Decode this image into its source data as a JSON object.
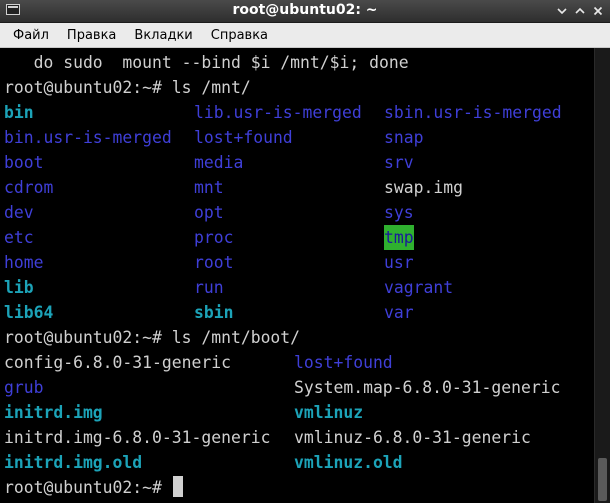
{
  "window": {
    "title": "root@ubuntu02: ~"
  },
  "menu": [
    "Файл",
    "Правка",
    "Вкладки",
    "Справка"
  ],
  "terminal": {
    "line0": "   do sudo  mount --bind $i /mnt/$i; done",
    "prompt1": "root@ubuntu02:~# ls /mnt/",
    "mnt_col1": [
      "bin",
      "bin.usr-is-merged",
      "boot",
      "cdrom",
      "dev",
      "etc",
      "home",
      "lib",
      "lib64"
    ],
    "mnt_col2": [
      "lib.usr-is-merged",
      "lost+found",
      "media",
      "mnt",
      "opt",
      "proc",
      "root",
      "run",
      "sbin"
    ],
    "mnt_col3": [
      "sbin.usr-is-merged",
      "snap",
      "srv",
      "swap.img",
      "sys",
      "tmp",
      "usr",
      "vagrant",
      "var"
    ],
    "prompt2": "root@ubuntu02:~# ls /mnt/boot/",
    "boot_col1": [
      "config-6.8.0-31-generic",
      "grub",
      "initrd.img",
      "initrd.img-6.8.0-31-generic",
      "initrd.img.old"
    ],
    "boot_col2": [
      "lost+found",
      "System.map-6.8.0-31-generic",
      "vmlinuz",
      "vmlinuz-6.8.0-31-generic",
      "vmlinuz.old"
    ],
    "prompt3": "root@ubuntu02:~# "
  },
  "colors": {
    "directory": "#3f3fd8",
    "symlink": "#1ca3b8",
    "file": "#d0d0d0",
    "sticky_dir_bg": "#2fb02f"
  },
  "icons": {
    "window": "terminal-window-icon",
    "minimize": "minimize-icon",
    "maximize": "maximize-icon",
    "close": "close-icon"
  }
}
